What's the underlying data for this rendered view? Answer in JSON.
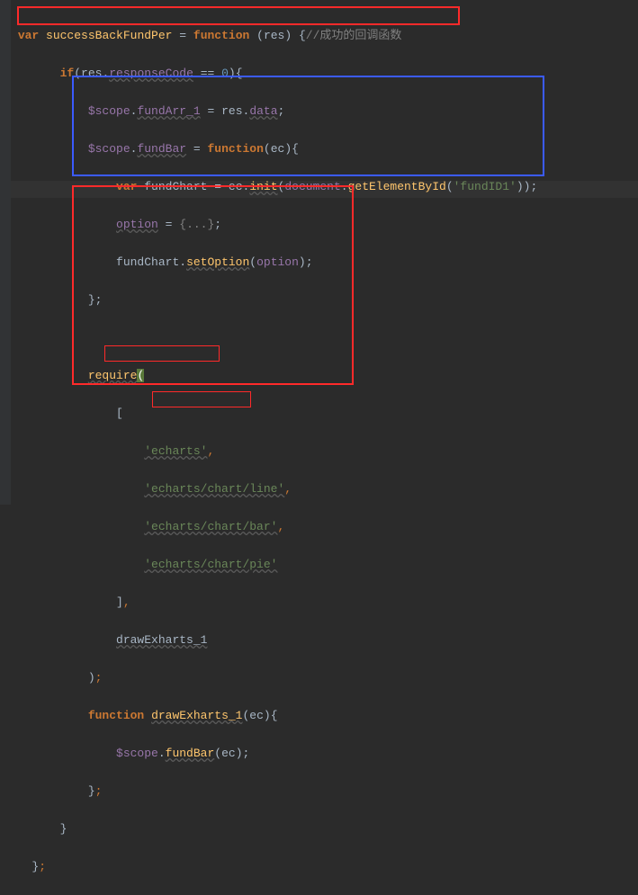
{
  "lines": {
    "l1_var": "var",
    "l1_name": "successBackFundPer",
    "l1_function": "function",
    "l1_param": "res",
    "l1_comment": "//成功的回调函数",
    "l2_if": "if",
    "l2_prop": "responseCode",
    "l2_eq": "==",
    "l2_val": "0",
    "l2_res": "res",
    "l3_scope": "$scope",
    "l3_prop": "fundArr_1",
    "l3_res": "res",
    "l3_data": "data",
    "l4_scope": "$scope",
    "l4_prop": "fundBar",
    "l4_function": "function",
    "l4_param": "ec",
    "l5_var": "var",
    "l5_name": "fundChart",
    "l5_ec": "ec",
    "l5_init": "init",
    "l5_doc": "document",
    "l5_get": "getElementById",
    "l5_str": "'fundID1'",
    "l6_option": "option",
    "l6_fold": "{...}",
    "l7_obj": "fundChart",
    "l7_set": "setOption",
    "l7_arg": "option",
    "l9_require": "require",
    "l12_str": "'echarts'",
    "l13_str": "'echarts/chart/line'",
    "l14_str": "'echarts/chart/bar'",
    "l15_str": "'echarts/chart/pie'",
    "l17_name": "drawExharts_1",
    "l19_function": "function",
    "l19_name": "drawExharts_1",
    "l19_param": "ec",
    "l20_scope": "$scope",
    "l20_fn": "fundBar",
    "l20_arg": "ec"
  }
}
